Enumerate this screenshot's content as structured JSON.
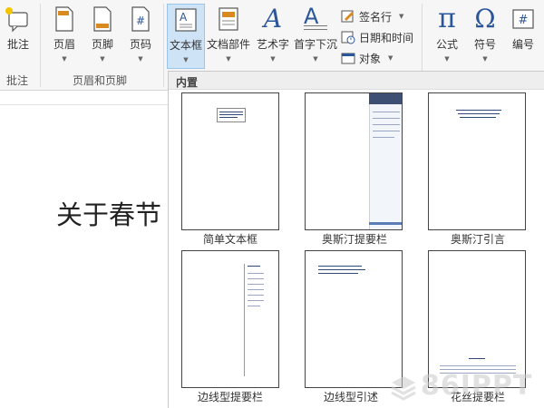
{
  "ribbon": {
    "groups": {
      "comments": "批注",
      "header_footer": "页眉和页脚"
    },
    "buttons": {
      "comment": "批注",
      "header": "页眉",
      "footer": "页脚",
      "page_number": "页码",
      "text_box": "文本框",
      "quick_parts": "文档部件",
      "wordart": "艺术字",
      "drop_cap": "首字下沉",
      "signature_line": "签名行",
      "date_time": "日期和时间",
      "object": "对象",
      "equation": "公式",
      "symbol": "符号",
      "number": "编号"
    },
    "icon_glyphs": {
      "equation": "π",
      "symbol": "Ω",
      "number": "#",
      "page_number": "#",
      "wordart": "A",
      "drop_cap": "A"
    }
  },
  "document": {
    "text": "关于春节"
  },
  "gallery": {
    "section_title": "内置",
    "items": [
      "简单文本框",
      "奥斯汀提要栏",
      "奥斯汀引言",
      "边线型提要栏",
      "边线型引述",
      "花丝提要栏"
    ]
  },
  "watermark": {
    "text": "86IPPT"
  },
  "colors": {
    "accent": "#2b579a",
    "active_button": "#cfe3f7",
    "ribbon_bg": "#f6f6f6"
  }
}
